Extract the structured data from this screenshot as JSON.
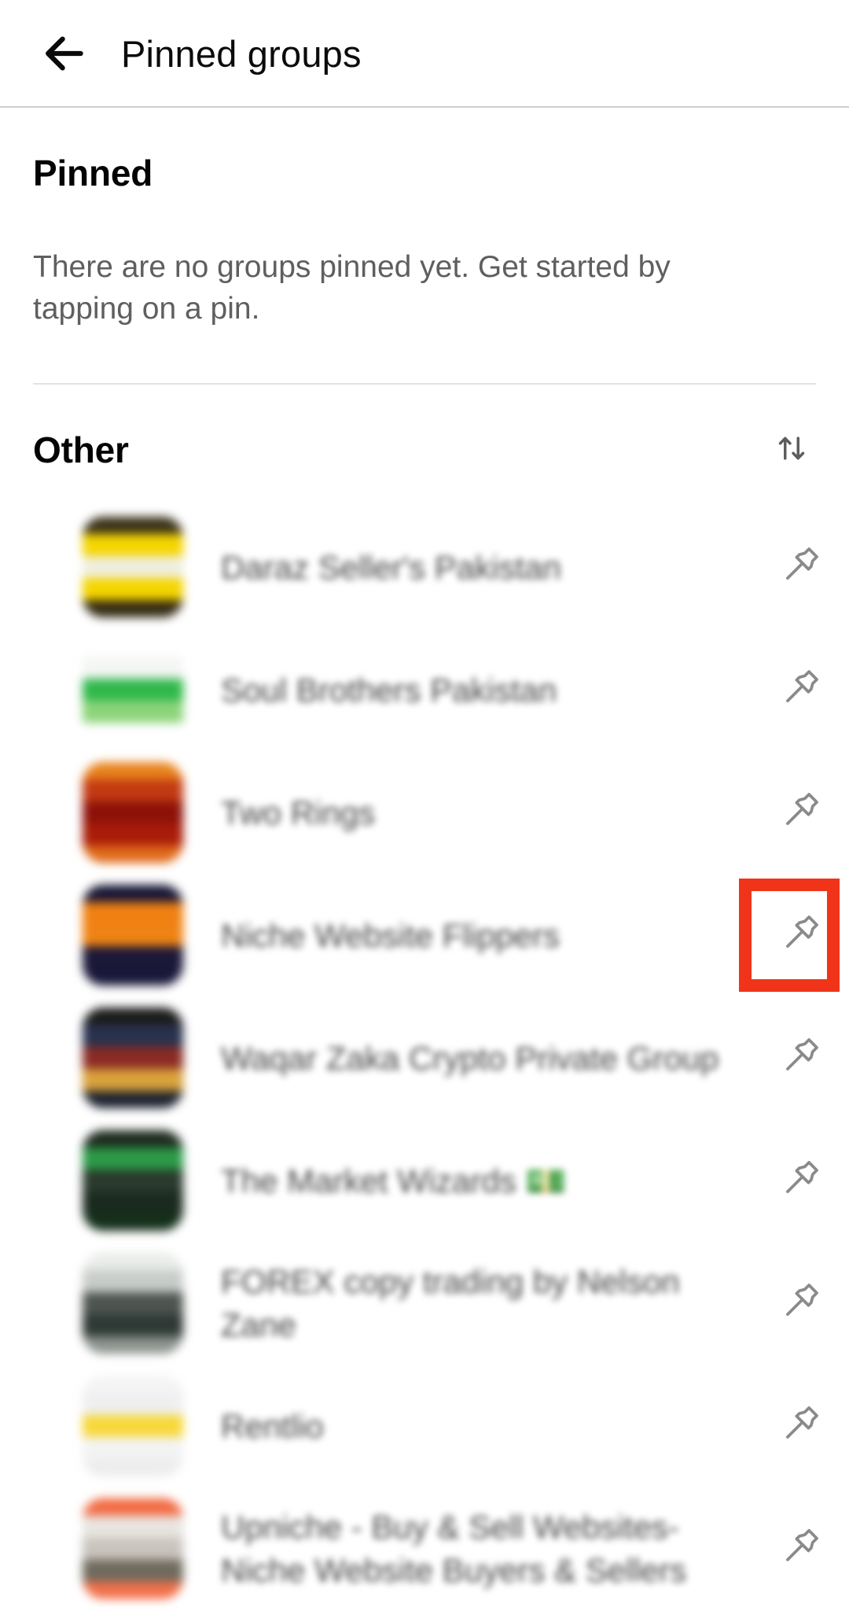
{
  "appbar": {
    "back_icon": "back-arrow-icon",
    "title": "Pinned groups"
  },
  "pinned_section": {
    "title": "Pinned",
    "empty_message": "There are no groups pinned yet. Get started by tapping on a pin."
  },
  "other_section": {
    "title": "Other",
    "sort_icon": "sort-arrows-icon",
    "groups": [
      {
        "name": "Daraz Seller's Pakistan",
        "avatar_colors": [
          "#3a3118",
          "#f5d500",
          "#efeedf",
          "#f5d500",
          "#332b14"
        ],
        "pin_icon": "pin-icon",
        "highlighted": false
      },
      {
        "name": "Soul Brothers Pakistan",
        "avatar_colors": [
          "#ffffff",
          "#f4f6f4",
          "#2fb84a",
          "#8cd47a",
          "#ffffff"
        ],
        "pin_icon": "pin-icon",
        "highlighted": false
      },
      {
        "name": "Two Rings",
        "avatar_colors": [
          "#e8821c",
          "#c23a12",
          "#8d1108",
          "#a81c09",
          "#e06a1a"
        ],
        "pin_icon": "pin-icon",
        "highlighted": false
      },
      {
        "name": "Niche Website Flippers",
        "avatar_colors": [
          "#161535",
          "#f08012",
          "#ef8314",
          "#1b1838",
          "#19183a"
        ],
        "pin_icon": "pin-icon",
        "highlighted": true
      },
      {
        "name": "Waqar Zaka Crypto Private Group",
        "avatar_colors": [
          "#1b1b1b",
          "#28324e",
          "#8a2b24",
          "#d9a23b",
          "#1d2430"
        ],
        "pin_icon": "pin-icon",
        "highlighted": false
      },
      {
        "name": "The Market Wizards 💵",
        "avatar_colors": [
          "#1d2a1d",
          "#2c9a48",
          "#2a3a2c",
          "#1a2a1e",
          "#14301b"
        ],
        "pin_icon": "pin-icon",
        "highlighted": false
      },
      {
        "name": "FOREX copy trading by Nelson Zane",
        "avatar_colors": [
          "#e9ece9",
          "#c8ccc9",
          "#4d5550",
          "#2e3834",
          "#8d948f"
        ],
        "pin_icon": "pin-icon",
        "highlighted": false
      },
      {
        "name": "Rentlio",
        "avatar_colors": [
          "#f4f4f4",
          "#efefef",
          "#f7d83a",
          "#f3f3f3",
          "#ededed"
        ],
        "pin_icon": "pin-icon",
        "highlighted": false
      },
      {
        "name": "Upniche - Buy & Sell Websites- Niche Website Buyers & Sellers",
        "avatar_colors": [
          "#f26a42",
          "#e8e5e0",
          "#c9c4bd",
          "#6f6a5e",
          "#f2704a"
        ],
        "pin_icon": "pin-icon",
        "highlighted": false
      }
    ]
  },
  "colors": {
    "highlight": "#f0341a",
    "divider": "#e2e2e2",
    "appbar_divider": "#cfcfcf",
    "title_text": "#040404",
    "body_text": "#5f5f5f",
    "group_text": "#454545",
    "pin_icon": "#8a8a8a"
  }
}
